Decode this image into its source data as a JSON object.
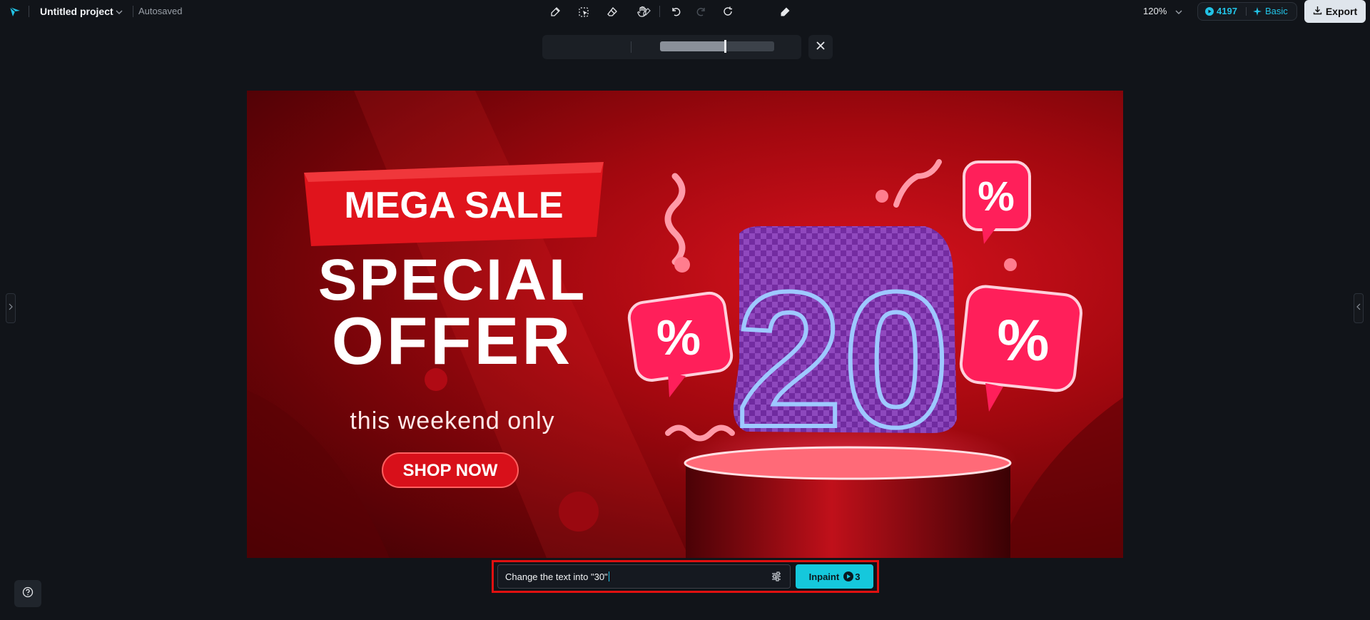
{
  "header": {
    "logo_icon": "logo-arrow-icon",
    "project_title": "Untitled project",
    "save_status": "Autosaved",
    "zoom_level": "120%",
    "credits": "4197",
    "plan_label": "Basic",
    "export_label": "Export"
  },
  "history": {
    "pan_icon": "hand-icon",
    "undo_icon": "undo-icon",
    "redo_icon": "redo-icon",
    "refresh_icon": "refresh-icon"
  },
  "brush_toolbar": {
    "tools": [
      "brush-icon",
      "smart-select-icon",
      "eraser-icon"
    ],
    "brush_size_fraction": 0.57,
    "close_icon": "close-icon"
  },
  "canvas_image": {
    "badge_text": "MEGA SALE",
    "headline_line1": "SPECIAL",
    "headline_line2": "OFFER",
    "subline": "this weekend only",
    "cta_text": "SHOP NOW",
    "big_number": "20",
    "percent_symbol": "%"
  },
  "prompt": {
    "value": "Change the text into \"30\"",
    "settings_icon": "sliders-icon",
    "inpaint_label": "Inpaint",
    "cost": "3"
  },
  "colors": {
    "accent": "#15c8dc",
    "highlight_frame": "#e01010",
    "background": "#111419"
  }
}
